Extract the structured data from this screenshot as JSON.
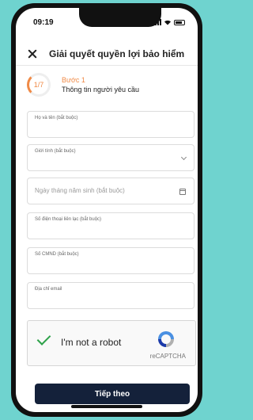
{
  "status_bar": {
    "time": "09:19",
    "icons": [
      "alarm-icon",
      "signal-icon",
      "wifi-icon",
      "battery-icon"
    ]
  },
  "header": {
    "title": "Giải quyết quyền lợi bảo hiểm",
    "close_icon": "close-icon"
  },
  "step": {
    "progress": "1/7",
    "label": "Bước 1",
    "description": "Thông tin người yêu cầu"
  },
  "fields": [
    {
      "label": "Họ và tên (bắt buộc)",
      "placeholder": ""
    },
    {
      "label": "Giới tính (bắt buộc)",
      "placeholder": ""
    },
    {
      "label": "",
      "placeholder": "Ngày tháng năm sinh (bắt buộc)"
    },
    {
      "label": "Số điện thoại liên lạc (bắt buộc)",
      "placeholder": ""
    },
    {
      "label": "Số CMND (bắt buộc)",
      "placeholder": ""
    },
    {
      "label": "Địa chỉ email",
      "placeholder": ""
    }
  ],
  "recaptcha": {
    "label": "I'm not a robot",
    "brand": "reCAPTCHA",
    "checked": true
  },
  "submit": {
    "label": "Tiếp theo"
  },
  "colors": {
    "accent": "#f08a46",
    "button": "#14213a",
    "background": "#6fd3cf",
    "check": "#2ea24a"
  }
}
